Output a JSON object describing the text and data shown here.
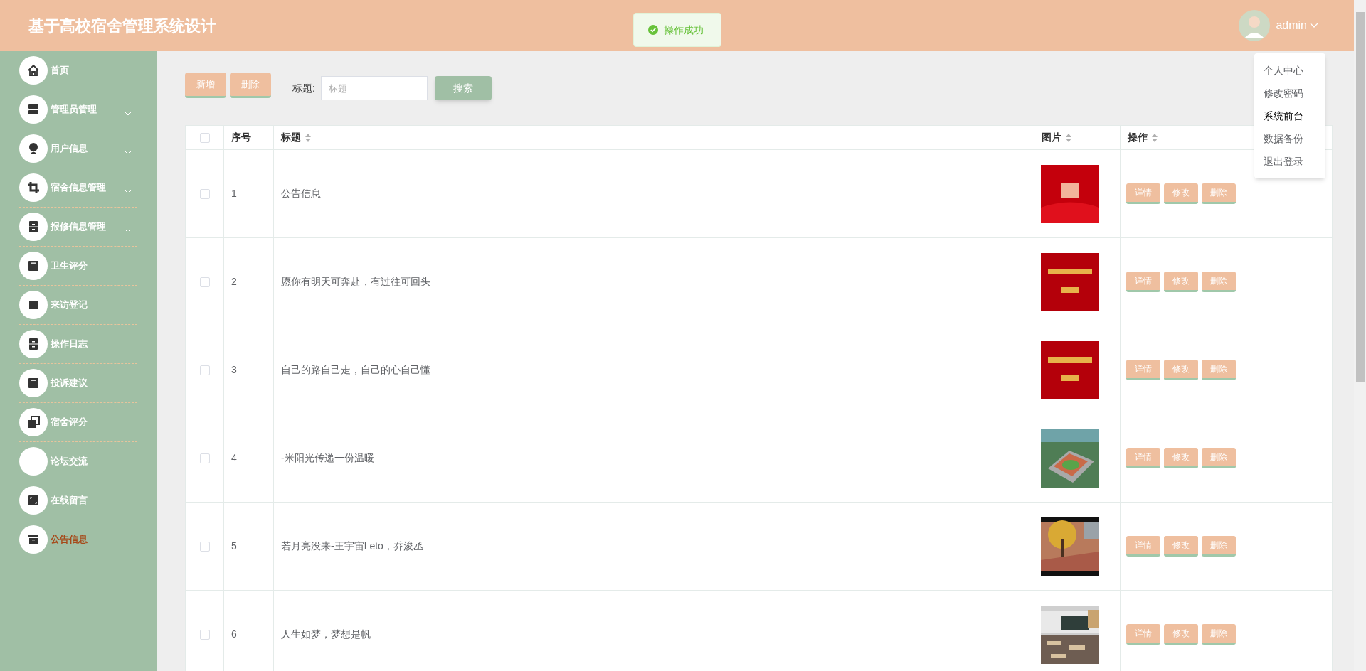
{
  "header": {
    "title": "基于高校宿舍管理系统设计",
    "user": "admin"
  },
  "toast": {
    "text": "操作成功"
  },
  "user_menu": [
    {
      "label": "个人中心",
      "hovered": false
    },
    {
      "label": "修改密码",
      "hovered": false
    },
    {
      "label": "系统前台",
      "hovered": true
    },
    {
      "label": "数据备份",
      "hovered": false
    },
    {
      "label": "退出登录",
      "hovered": false
    }
  ],
  "sidebar": {
    "items": [
      {
        "label": "首页",
        "expandable": false,
        "selected": false
      },
      {
        "label": "管理员管理",
        "expandable": true,
        "selected": false
      },
      {
        "label": "用户信息",
        "expandable": true,
        "selected": false
      },
      {
        "label": "宿舍信息管理",
        "expandable": true,
        "selected": false
      },
      {
        "label": "报修信息管理",
        "expandable": true,
        "selected": false
      },
      {
        "label": "卫生评分",
        "expandable": false,
        "selected": false
      },
      {
        "label": "来访登记",
        "expandable": false,
        "selected": false
      },
      {
        "label": "操作日志",
        "expandable": false,
        "selected": false
      },
      {
        "label": "投诉建议",
        "expandable": false,
        "selected": false
      },
      {
        "label": "宿舍评分",
        "expandable": false,
        "selected": false
      },
      {
        "label": "论坛交流",
        "expandable": false,
        "selected": false
      },
      {
        "label": "在线留言",
        "expandable": false,
        "selected": false
      },
      {
        "label": "公告信息",
        "expandable": false,
        "selected": true
      }
    ]
  },
  "toolbar": {
    "buttons": [
      "新增",
      "删除"
    ],
    "search_label": "标题:",
    "search_placeholder": "标题",
    "search_button": "搜索"
  },
  "table": {
    "select_all": {
      "checked": false
    },
    "columns": [
      {
        "label": "序号",
        "sortable": false
      },
      {
        "label": "标题",
        "sortable": true
      },
      {
        "label": "图片",
        "sortable": true
      },
      {
        "label": "操作",
        "sortable": true
      }
    ],
    "rows": [
      {
        "index": "1",
        "title": "公告信息",
        "checked": false,
        "actions": [
          "详情",
          "修改",
          "删除"
        ]
      },
      {
        "index": "2",
        "title": "愿你有明天可奔赴，有过往可回头",
        "checked": false,
        "actions": [
          "详情",
          "修改",
          "删除"
        ]
      },
      {
        "index": "3",
        "title": "自己的路自己走，自己的心自己懂",
        "checked": false,
        "actions": [
          "详情",
          "修改",
          "删除"
        ]
      },
      {
        "index": "4",
        "title": "-米阳光传递一份温暖",
        "checked": false,
        "actions": [
          "详情",
          "修改",
          "删除"
        ]
      },
      {
        "index": "5",
        "title": "若月亮没来-王宇宙Leto，乔浚丞",
        "checked": false,
        "actions": [
          "详情",
          "修改",
          "删除"
        ]
      },
      {
        "index": "6",
        "title": "人生如梦，梦想是帆",
        "checked": false,
        "actions": [
          "详情",
          "修改",
          "删除"
        ]
      }
    ]
  }
}
